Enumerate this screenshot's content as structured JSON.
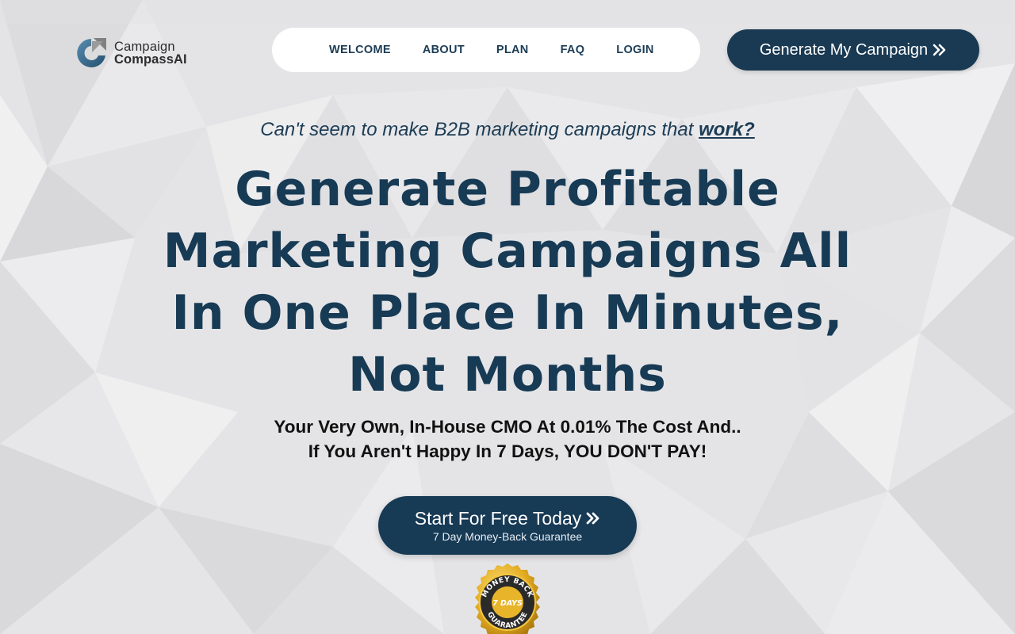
{
  "brand": {
    "line1": "Campaign",
    "line2": "CompassAI",
    "colors": {
      "primary": "#173a55",
      "logo_blue": "#3b6d8f",
      "logo_gray": "#7a7a7a",
      "gold": "#e0a81e"
    }
  },
  "nav": {
    "items": [
      "WELCOME",
      "ABOUT",
      "PLAN",
      "FAQ",
      "LOGIN"
    ]
  },
  "header_cta": {
    "label": "Generate My Campaign",
    "icon": "double-chevron-right-icon"
  },
  "hero": {
    "tagline_main": "Can't seem to make B2B marketing campaigns that ",
    "tagline_emphasis": "work?",
    "headline": "Generate Profitable Marketing Campaigns All In One Place In Minutes, Not Months",
    "subhead_line1": "Your Very Own, In-House CMO At 0.01% The Cost And..",
    "subhead_line2": "If You Aren't Happy In 7 Days, YOU DON'T PAY!"
  },
  "main_cta": {
    "label": "Start For Free Today",
    "sublabel": "7 Day Money-Back Guarantee",
    "icon": "double-chevron-right-icon"
  },
  "badge": {
    "top_text": "MONEY BACK",
    "center_text": "7 DAYS",
    "bottom_text": "GUARANTEE",
    "icon": "money-back-seal-icon"
  }
}
